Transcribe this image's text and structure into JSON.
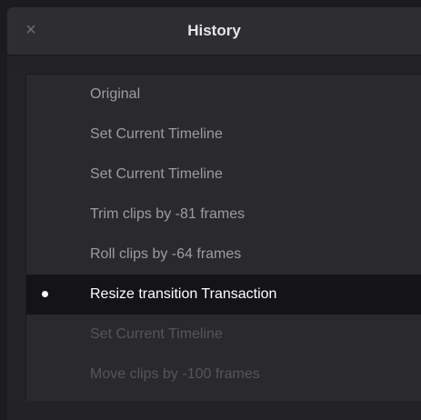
{
  "window": {
    "title": "History",
    "close_icon": "×"
  },
  "history": {
    "items": [
      {
        "label": "Original",
        "state": "past"
      },
      {
        "label": "Set Current Timeline",
        "state": "past"
      },
      {
        "label": "Set Current Timeline",
        "state": "past"
      },
      {
        "label": "Trim clips by -81 frames",
        "state": "past"
      },
      {
        "label": "Roll clips by -64 frames",
        "state": "past"
      },
      {
        "label": "Resize transition Transaction",
        "state": "current"
      },
      {
        "label": "Set Current Timeline",
        "state": "future"
      },
      {
        "label": "Move clips by -100 frames",
        "state": "future"
      }
    ]
  },
  "colors": {
    "window_bg": "#242427",
    "titlebar_bg": "#2e2e31",
    "current_row_bg": "#141416",
    "past_text": "#9c9ca2",
    "future_text": "#55555a",
    "current_text": "#ffffff"
  }
}
